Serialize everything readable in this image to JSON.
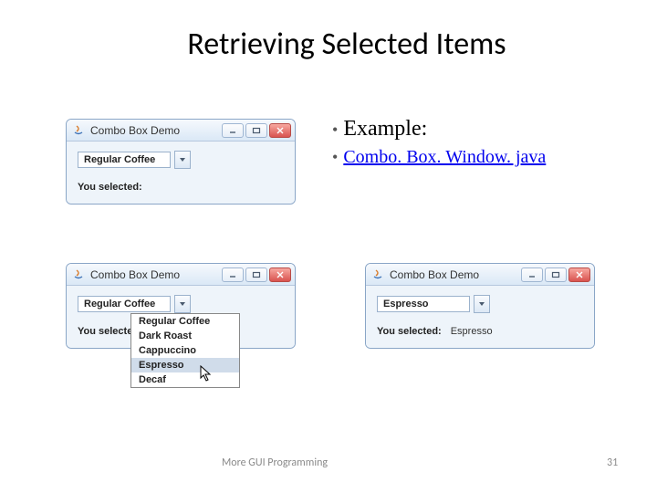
{
  "title": "Retrieving Selected Items",
  "bullets": {
    "example": "Example:",
    "link": "Combo. Box. Window. java"
  },
  "window": {
    "title": "Combo Box Demo",
    "selected_label": "You selected:"
  },
  "combo": {
    "value_regular": "Regular Coffee",
    "value_espresso": "Espresso"
  },
  "dropdown": {
    "items": [
      "Regular Coffee",
      "Dark Roast",
      "Cappuccino",
      "Espresso",
      "Decaf"
    ]
  },
  "selected_value_espresso": "Espresso",
  "footer": {
    "left": "More GUI Programming",
    "page": "31"
  }
}
